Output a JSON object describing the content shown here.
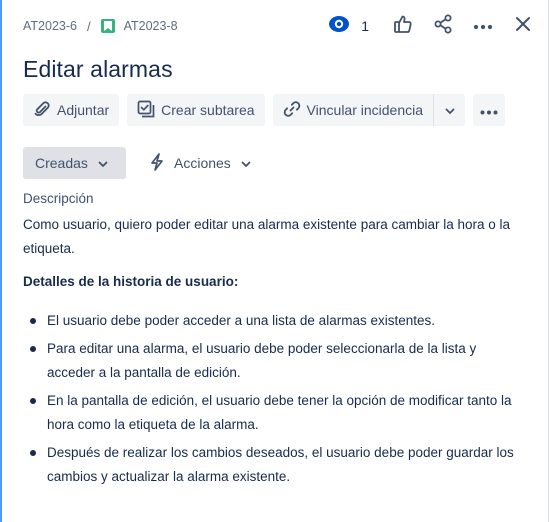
{
  "breadcrumb": {
    "parent": "AT2023-6",
    "separator": "/",
    "current": "AT2023-8"
  },
  "watchers": {
    "count": "1"
  },
  "icons": {
    "watch": "eye-icon",
    "like": "thumbs-up-icon",
    "share": "share-icon",
    "more": "more-icon",
    "close": "close-icon",
    "attach": "paperclip-icon",
    "subtask": "subtask-icon",
    "link": "link-icon",
    "actions": "lightning-icon",
    "story": "bookmark-icon"
  },
  "colors": {
    "accent": "#0052cc",
    "story": "#36b37e",
    "button_bg": "#f4f5f7",
    "status_bg": "#dfe1e6",
    "frame": "#4c9aff"
  },
  "title": "Editar alarmas",
  "toolbar": {
    "attach_label": "Adjuntar",
    "subtask_label": "Crear subtarea",
    "link_label": "Vincular incidencia"
  },
  "status": {
    "label": "Creadas",
    "actions_label": "Acciones"
  },
  "description": {
    "heading": "Descripción",
    "text": "Como usuario, quiero poder editar una alarma existente para cambiar la hora o la etiqueta.",
    "subheading": "Detalles de la historia de usuario:",
    "items": [
      "El usuario debe poder acceder a una lista de alarmas existentes.",
      "Para editar una alarma, el usuario debe poder seleccionarla de la lista y acceder a la pantalla de edición.",
      "En la pantalla de edición, el usuario debe tener la opción de modificar tanto la hora como la etiqueta de la alarma.",
      "Después de realizar los cambios deseados, el usuario debe poder guardar los cambios y actualizar la alarma existente."
    ]
  }
}
